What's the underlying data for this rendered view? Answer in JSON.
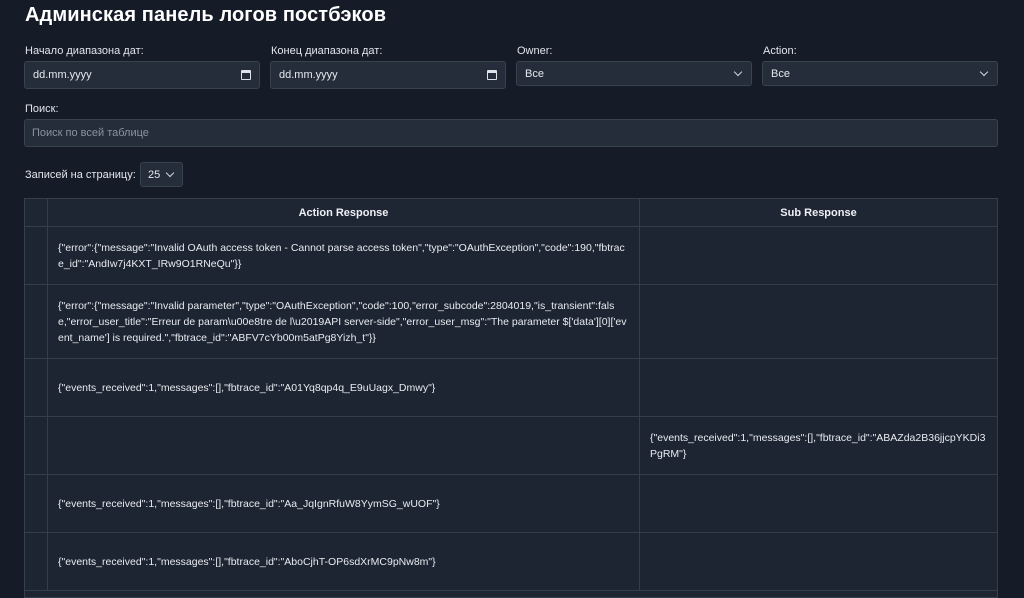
{
  "page": {
    "title": "Админская панель логов постбэков"
  },
  "filters": {
    "date_from": {
      "label": "Начало диапазона дат:",
      "value": "dd.mm.yyyy"
    },
    "date_to": {
      "label": "Конец диапазона дат:",
      "value": "dd.mm.yyyy"
    },
    "owner": {
      "label": "Owner:",
      "value": "Все"
    },
    "action": {
      "label": "Action:",
      "value": "Все"
    }
  },
  "search": {
    "label": "Поиск:",
    "placeholder": "Поиск по всей таблице"
  },
  "pagination": {
    "label": "Записей на страницу:",
    "value": "25"
  },
  "table": {
    "columns": [
      "",
      "Action Response",
      "Sub Response"
    ],
    "rows": [
      {
        "action_response": "{\"error\":{\"message\":\"Invalid OAuth access token - Cannot parse access token\",\"type\":\"OAuthException\",\"code\":190,\"fbtrace_id\":\"AndIw7j4KXT_IRw9O1RNeQu\"}}",
        "sub_response": ""
      },
      {
        "action_response": "{\"error\":{\"message\":\"Invalid parameter\",\"type\":\"OAuthException\",\"code\":100,\"error_subcode\":2804019,\"is_transient\":false,\"error_user_title\":\"Erreur de param\\u00e8tre de l\\u2019API server-side\",\"error_user_msg\":\"The parameter $['data'][0]['event_name'] is required.\",\"fbtrace_id\":\"ABFV7cYb00m5atPg8Yizh_t\"}}",
        "sub_response": ""
      },
      {
        "action_response": "{\"events_received\":1,\"messages\":[],\"fbtrace_id\":\"A01Yq8qp4q_E9uUagx_Dmwy\"}",
        "sub_response": ""
      },
      {
        "action_response": "",
        "sub_response": "{\"events_received\":1,\"messages\":[],\"fbtrace_id\":\"ABAZda2B36jjcpYKDi3PgRM\"}"
      },
      {
        "action_response": "{\"events_received\":1,\"messages\":[],\"fbtrace_id\":\"Aa_JqIgnRfuW8YymSG_wUOF\"}",
        "sub_response": ""
      },
      {
        "action_response": "{\"events_received\":1,\"messages\":[],\"fbtrace_id\":\"AboCjhT-OP6sdXrMC9pNw8m\"}",
        "sub_response": ""
      }
    ]
  }
}
